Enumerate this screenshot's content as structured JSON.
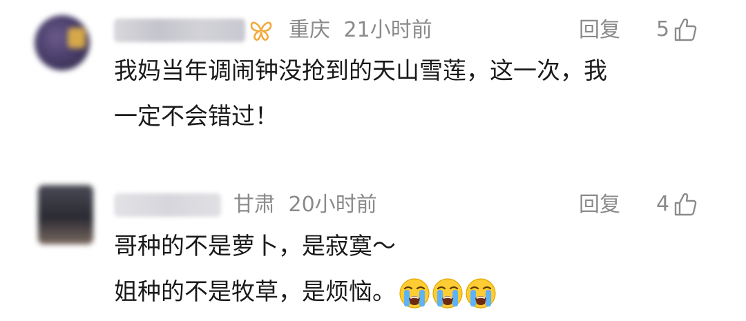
{
  "comments": [
    {
      "location": "重庆",
      "time": "21小时前",
      "reply_label": "回复",
      "likes": "5",
      "has_badge": true,
      "lines": [
        "我妈当年调闹钟没抢到的天山雪莲，这一次，我",
        "一定不会错过！"
      ]
    },
    {
      "location": "甘肃",
      "time": "20小时前",
      "reply_label": "回复",
      "likes": "4",
      "has_badge": false,
      "lines": [
        "哥种的不是萝卜，是寂寞～",
        "姐种的不是牧草，是烦恼。"
      ],
      "emojis": [
        "loudly-crying-face",
        "loudly-crying-face",
        "loudly-crying-face"
      ]
    }
  ],
  "colors": {
    "meta_text": "#8a8a8a",
    "body_text": "#1a1a1a",
    "badge": "#f2a93b",
    "emoji_face": "#ffcc33",
    "emoji_tears": "#5fb3f5"
  }
}
